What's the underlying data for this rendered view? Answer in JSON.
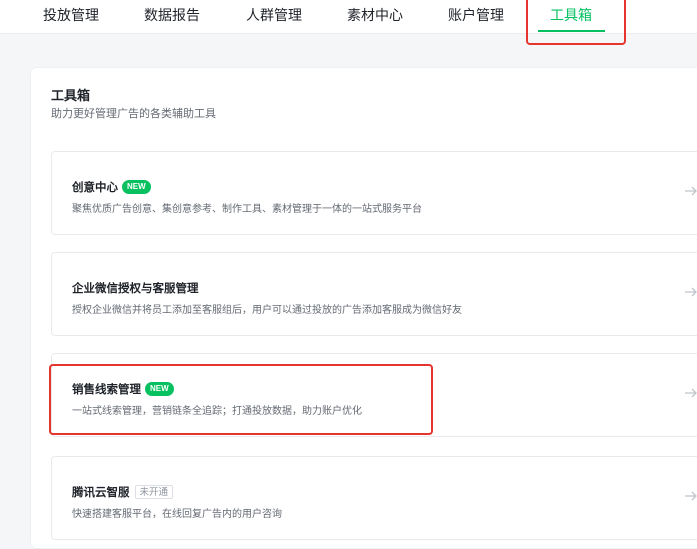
{
  "nav": {
    "tabs": [
      {
        "label": "投放管理"
      },
      {
        "label": "数据报告"
      },
      {
        "label": "人群管理"
      },
      {
        "label": "素材中心"
      },
      {
        "label": "账户管理"
      },
      {
        "label": "工具箱",
        "active": true
      }
    ]
  },
  "toolbox": {
    "title": "工具箱",
    "subtitle": "助力更好管理广告的各类辅助工具",
    "cards": [
      {
        "title": "创意中心",
        "badge": "NEW",
        "description": "聚焦优质广告创意、集创意参考、制作工具、素材管理于一体的一站式服务平台"
      },
      {
        "title": "企业微信授权与客服管理",
        "description": "授权企业微信并将员工添加至客服组后，用户可以通过投放的广告添加客服成为微信好友"
      },
      {
        "title": "销售线索管理",
        "badge": "NEW",
        "description": "一站式线索管理，营销链条全追踪；打通投放数据，助力账户优化"
      },
      {
        "title": "腾讯云智服",
        "status": "未开通",
        "description": "快速搭建客服平台，在线回复广告内的用户咨询"
      }
    ]
  },
  "colors": {
    "accent": "#07c160",
    "highlight": "#e5352e"
  },
  "icons": {
    "card_arrow": "arrow-right-icon"
  }
}
